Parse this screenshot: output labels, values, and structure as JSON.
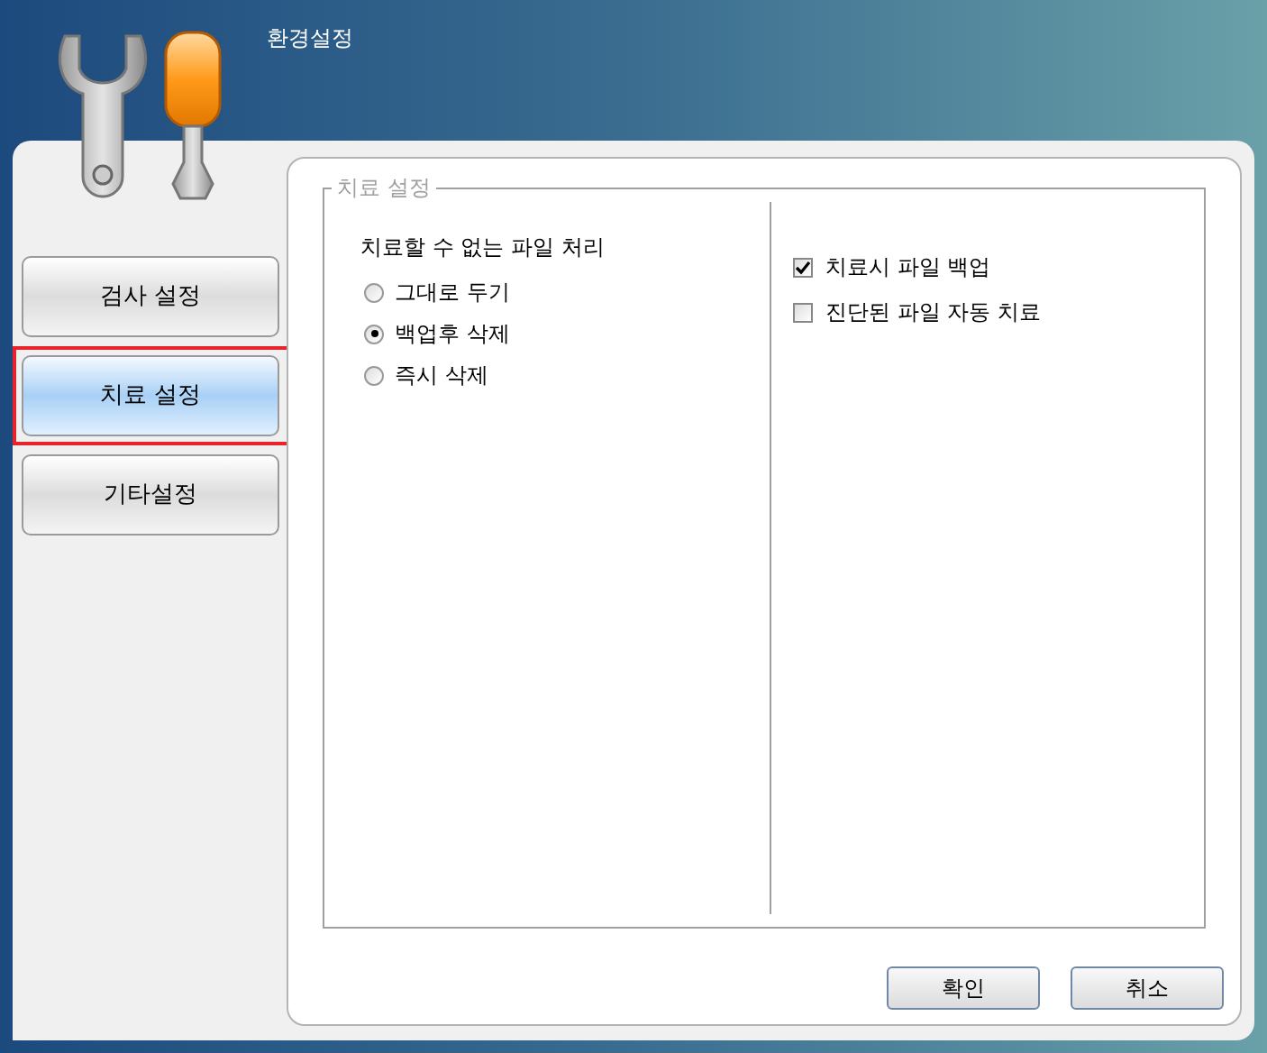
{
  "window": {
    "title": "환경설정"
  },
  "sidebar": {
    "items": [
      {
        "label": "검사 설정",
        "selected": false
      },
      {
        "label": "치료 설정",
        "selected": true
      },
      {
        "label": "기타설정",
        "selected": false
      }
    ]
  },
  "group": {
    "title": "치료 설정",
    "left": {
      "heading": "치료할 수 없는 파일 처리",
      "options": [
        {
          "label": "그대로 두기",
          "selected": false
        },
        {
          "label": "백업후 삭제",
          "selected": true
        },
        {
          "label": "즉시 삭제",
          "selected": false
        }
      ]
    },
    "right": {
      "checkboxes": [
        {
          "label": "치료시 파일 백업",
          "checked": true
        },
        {
          "label": "진단된 파일 자동 치료",
          "checked": false
        }
      ]
    }
  },
  "buttons": [
    "확인",
    "취소"
  ]
}
